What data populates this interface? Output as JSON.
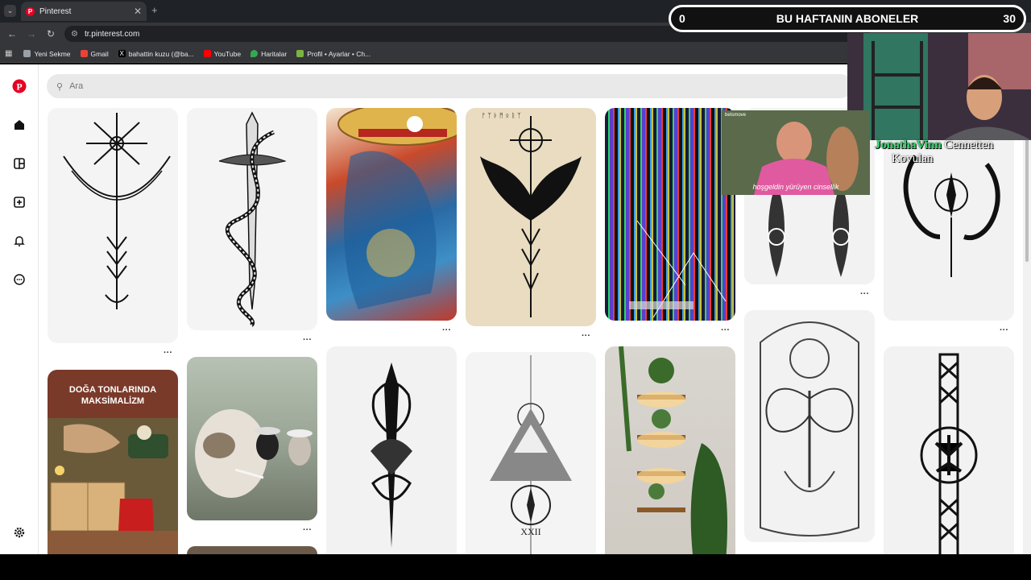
{
  "browser": {
    "tab_title": "Pinterest",
    "tab_icon": "pinterest-icon",
    "url": "tr.pinterest.com",
    "bookmarks": [
      {
        "label": "Yeni Sekme",
        "icon": "newtab-icon",
        "color": "#9aa0a6"
      },
      {
        "label": "Gmail",
        "icon": "gmail-icon",
        "color": "#ea4335"
      },
      {
        "label": "bahattin kuzu (@ba...",
        "icon": "x-icon",
        "color": "#000000"
      },
      {
        "label": "YouTube",
        "icon": "youtube-icon",
        "color": "#ff0000"
      },
      {
        "label": "Haritalar",
        "icon": "maps-icon",
        "color": "#34a853"
      },
      {
        "label": "Profil • Ayarlar • Ch...",
        "icon": "profile-icon",
        "color": "#7cb342"
      }
    ]
  },
  "pinterest": {
    "search_placeholder": "Ara",
    "brand_color": "#e60023",
    "sidebar_icons": [
      "home-icon",
      "explore-icon",
      "create-icon",
      "notifications-icon",
      "messages-icon",
      "settings-icon"
    ],
    "pins": [
      {
        "name": "pin-vegvisir-tattoo",
        "overlay_text": ""
      },
      {
        "name": "pin-snake-dagger-tattoo",
        "overlay_text": ""
      },
      {
        "name": "pin-one-piece-art",
        "overlay_text": ""
      },
      {
        "name": "pin-raven-rune-tattoo",
        "overlay_text": ""
      },
      {
        "name": "pin-glitch-screen",
        "overlay_text": ""
      },
      {
        "name": "pin-nordic-tattoos",
        "overlay_text": ""
      },
      {
        "name": "pin-dragon-compass-tattoo",
        "overlay_text": ""
      },
      {
        "name": "pin-maximalism-interior",
        "overlay_text": "DOĞA TONLARINDA MAKSİMALİZM"
      },
      {
        "name": "pin-smoking-cat",
        "overlay_text": ""
      },
      {
        "name": "pin-dagger-ornament-tattoo",
        "overlay_text": ""
      },
      {
        "name": "pin-mountain-compass-tattoo",
        "overlay_text": "XXII"
      },
      {
        "name": "pin-glowing-shelves",
        "overlay_text": ""
      },
      {
        "name": "pin-moth-ornament-tattoo",
        "overlay_text": ""
      },
      {
        "name": "pin-celtic-tree-tattoo",
        "overlay_text": ""
      }
    ]
  },
  "stream_overlay": {
    "left_count": "0",
    "title": "BU HAFTANIN ABONELER",
    "right_count": "30",
    "watermark_green": "JonathaVinn",
    "watermark_white": "Cennetten",
    "watermark_line2": "Kovulan",
    "meme_caption": "hoşgeldin yürüyen cinsellik",
    "meme_brand": "betsmove"
  }
}
